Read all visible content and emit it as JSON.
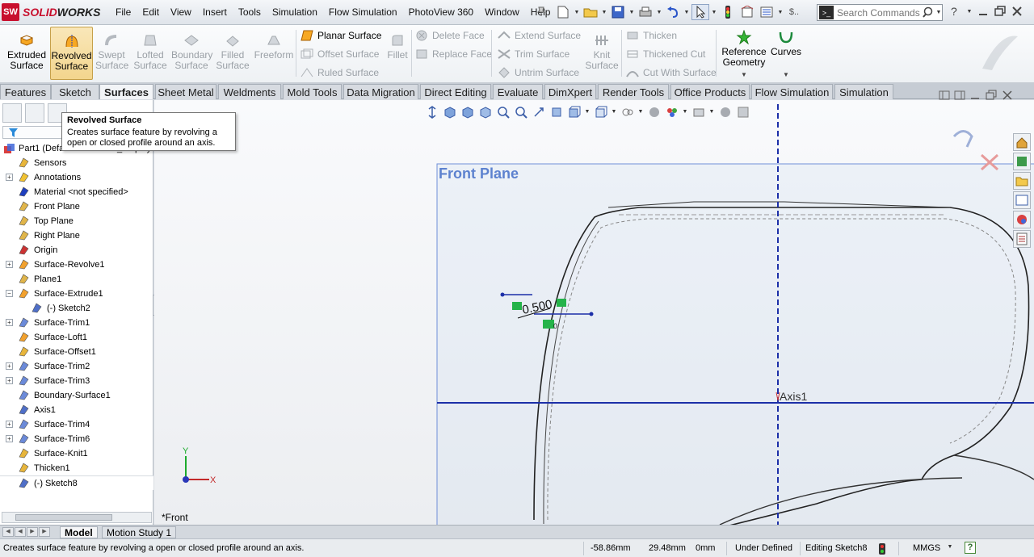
{
  "app": {
    "brand_prefix": "SOLID",
    "brand_suffix": "WORKS",
    "logo_mark": "SW"
  },
  "menus": [
    "File",
    "Edit",
    "View",
    "Insert",
    "Tools",
    "Simulation",
    "Flow Simulation",
    "PhotoView 360",
    "Window",
    "Help"
  ],
  "search": {
    "placeholder": "Search Commands",
    "term_glyph": ">_"
  },
  "command_manager": {
    "big_buttons": [
      {
        "label": "Extruded Surface",
        "line1": "Extruded",
        "line2": "Surface",
        "state": "enabled",
        "icon": "extruded-surface-icon"
      },
      {
        "label": "Revolved Surface",
        "line1": "Revolved",
        "line2": "Surface",
        "state": "hover",
        "icon": "revolved-surface-icon"
      },
      {
        "label": "Swept Surface",
        "line1": "Swept",
        "line2": "Surface",
        "state": "disabled",
        "icon": "swept-surface-icon"
      },
      {
        "label": "Lofted Surface",
        "line1": "Lofted",
        "line2": "Surface",
        "state": "disabled",
        "icon": "lofted-surface-icon"
      },
      {
        "label": "Boundary Surface",
        "line1": "Boundary",
        "line2": "Surface",
        "state": "disabled",
        "icon": "boundary-surface-icon"
      },
      {
        "label": "Filled Surface",
        "line1": "Filled",
        "line2": "Surface",
        "state": "disabled",
        "icon": "filled-surface-icon"
      },
      {
        "label": "Freeform",
        "line1": "Freeform",
        "line2": "",
        "state": "disabled",
        "icon": "freeform-icon"
      }
    ],
    "planar": "Planar Surface",
    "offset": "Offset Surface",
    "ruled": "Ruled Surface",
    "fillet": "Fillet",
    "delete_face": "Delete Face",
    "replace_face": "Replace Face",
    "extend": "Extend Surface",
    "trim": "Trim Surface",
    "untrim": "Untrim Surface",
    "knit": {
      "line1": "Knit",
      "line2": "Surface"
    },
    "thicken": "Thicken",
    "thickened_cut": "Thickened Cut",
    "cut_with_surface": "Cut With Surface",
    "ref_geom": {
      "line1": "Reference",
      "line2": "Geometry"
    },
    "curves": "Curves"
  },
  "tabs": [
    "Features",
    "Sketch",
    "Surfaces",
    "Sheet Metal",
    "Weldments",
    "Mold Tools",
    "Data Migration",
    "Direct Editing",
    "Evaluate",
    "DimXpert",
    "Render Tools",
    "Office Products",
    "Flow Simulation",
    "Simulation"
  ],
  "active_tab": "Surfaces",
  "tooltip": {
    "title": "Revolved Surface",
    "line1": "Creates surface feature by revolving a",
    "line2": "open or closed profile around an axis."
  },
  "tree": {
    "root": "Part1  (Default<<Default>_Display",
    "items": [
      {
        "label": "Sensors",
        "icon": "sensors-icon",
        "expand": false
      },
      {
        "label": "Annotations",
        "icon": "annotations-icon",
        "expand": true
      },
      {
        "label": "Material <not specified>",
        "icon": "material-icon",
        "expand": false
      },
      {
        "label": "Front Plane",
        "icon": "plane-icon",
        "expand": false
      },
      {
        "label": "Top Plane",
        "icon": "plane-icon",
        "expand": false
      },
      {
        "label": "Right Plane",
        "icon": "plane-icon",
        "expand": false
      },
      {
        "label": "Origin",
        "icon": "origin-icon",
        "expand": false
      },
      {
        "label": "Surface-Revolve1",
        "icon": "surface-revolve-icon",
        "expand": true
      },
      {
        "label": "Plane1",
        "icon": "plane-icon",
        "expand": false
      },
      {
        "label": "Surface-Extrude1",
        "icon": "surface-extrude-icon",
        "expand": true,
        "open": true
      },
      {
        "label": "(-) Sketch2",
        "icon": "sketch-icon",
        "expand": false,
        "child": true
      },
      {
        "label": "Surface-Trim1",
        "icon": "surface-trim-icon",
        "expand": true
      },
      {
        "label": "Surface-Loft1",
        "icon": "surface-loft-icon",
        "expand": false
      },
      {
        "label": "Surface-Offset1",
        "icon": "surface-offset-icon",
        "expand": false
      },
      {
        "label": "Surface-Trim2",
        "icon": "surface-trim-icon",
        "expand": true
      },
      {
        "label": "Surface-Trim3",
        "icon": "surface-trim-icon",
        "expand": true
      },
      {
        "label": "Boundary-Surface1",
        "icon": "boundary-surface-icon",
        "expand": false
      },
      {
        "label": "Axis1",
        "icon": "axis-icon",
        "expand": false
      },
      {
        "label": "Surface-Trim4",
        "icon": "surface-trim-icon",
        "expand": true
      },
      {
        "label": "Surface-Trim6",
        "icon": "surface-trim-icon",
        "expand": true
      },
      {
        "label": "Surface-Knit1",
        "icon": "surface-knit-icon",
        "expand": false
      },
      {
        "label": "Thicken1",
        "icon": "thicken-icon",
        "expand": false
      },
      {
        "label": "(-) Sketch8",
        "icon": "sketch-icon",
        "expand": false,
        "editing": true
      }
    ]
  },
  "viewport": {
    "plane_label": "Front Plane",
    "axis_label": "Axis1",
    "dimension": "0.500",
    "relation_small": "0",
    "view_name": "*Front",
    "triad_x": "X",
    "triad_y": "Y"
  },
  "bottom_tabs": [
    "Model",
    "Motion Study 1"
  ],
  "status": {
    "message": "Creates surface feature by revolving a open or closed profile around an axis.",
    "x": "-58.86mm",
    "y": "29.48mm",
    "z": "0mm",
    "definition": "Under Defined",
    "editing": "Editing Sketch8",
    "units": "MMGS",
    "help": "?"
  },
  "colors": {
    "accent_blue": "#1f3fbf",
    "axis_blue": "#1c2fa8",
    "plane_border": "#6f8fd8",
    "brand_red": "#c8102e",
    "relation_green": "#25b34a"
  }
}
